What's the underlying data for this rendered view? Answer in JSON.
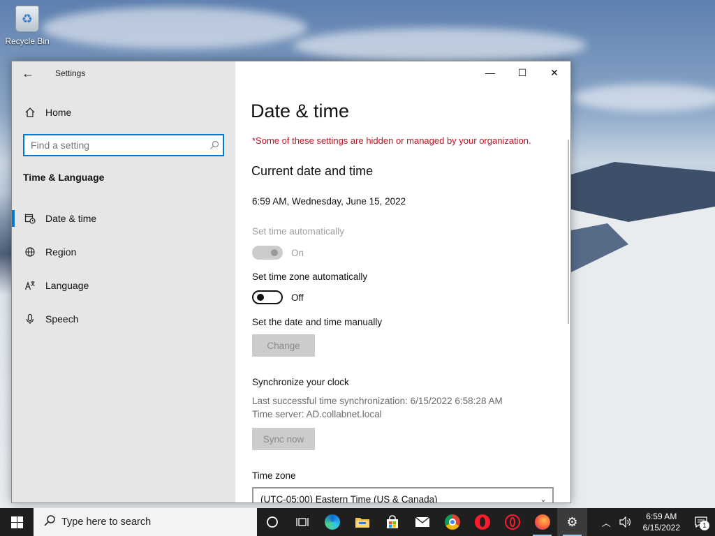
{
  "desktop": {
    "recycle_bin_label": "Recycle Bin"
  },
  "window": {
    "app_title": "Settings",
    "caption": {
      "minimize_glyph": "—",
      "maximize_glyph": "☐",
      "close_glyph": "✕"
    }
  },
  "sidebar": {
    "back_glyph": "←",
    "home_label": "Home",
    "search": {
      "placeholder": "Find a setting",
      "value": ""
    },
    "section_title": "Time & Language",
    "items": [
      {
        "label": "Date & time",
        "icon": "calendar-clock-icon",
        "active": true
      },
      {
        "label": "Region",
        "icon": "globe-icon",
        "active": false
      },
      {
        "label": "Language",
        "icon": "language-icon",
        "active": false
      },
      {
        "label": "Speech",
        "icon": "microphone-icon",
        "active": false
      }
    ]
  },
  "main": {
    "page_title": "Date & time",
    "managed_note": "*Some of these settings are hidden or managed by your organization.",
    "current_section_title": "Current date and time",
    "current_datetime": "6:59 AM, Wednesday, June 15, 2022",
    "set_time_auto": {
      "label": "Set time automatically",
      "state": "On",
      "enabled": false
    },
    "set_tz_auto": {
      "label": "Set time zone automatically",
      "state": "Off",
      "enabled": true
    },
    "manual": {
      "label": "Set the date and time manually",
      "button": "Change"
    },
    "sync": {
      "title": "Synchronize your clock",
      "last_sync": "Last successful time synchronization: 6/15/2022 6:58:28 AM",
      "server": "Time server: AD.collabnet.local",
      "button": "Sync now"
    },
    "time_zone": {
      "label": "Time zone",
      "value": "(UTC-05:00) Eastern Time (US & Canada)"
    }
  },
  "taskbar": {
    "search_placeholder": "Type here to search",
    "apps": [
      {
        "name": "cortana-icon"
      },
      {
        "name": "task-view-icon"
      },
      {
        "name": "edge-icon"
      },
      {
        "name": "file-explorer-icon"
      },
      {
        "name": "microsoft-store-icon"
      },
      {
        "name": "mail-icon"
      },
      {
        "name": "chrome-icon"
      },
      {
        "name": "opera-icon"
      },
      {
        "name": "opera-gx-icon"
      },
      {
        "name": "firefox-icon"
      },
      {
        "name": "settings-icon"
      }
    ],
    "clock": {
      "time": "6:59 AM",
      "date": "6/15/2022"
    },
    "notification_count": "1"
  },
  "colors": {
    "accent": "#0078d7",
    "warning_text": "#c50f1f",
    "taskbar": "#1f1f1f"
  }
}
